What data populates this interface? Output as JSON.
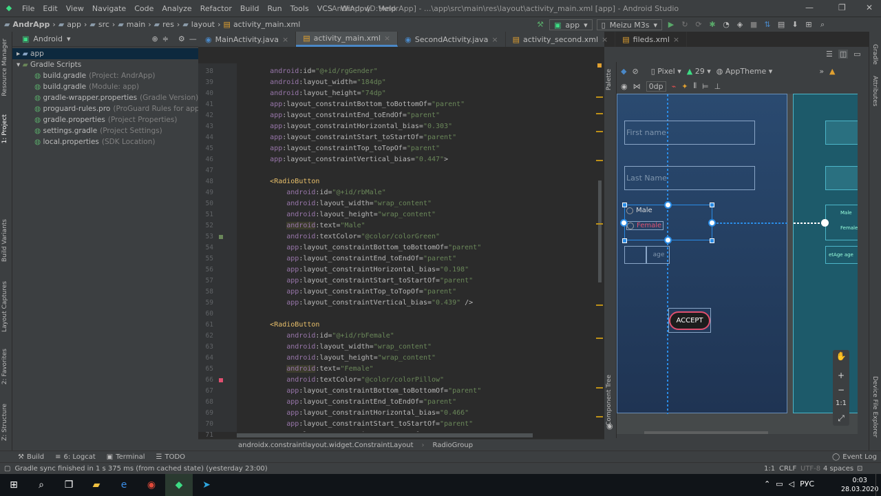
{
  "menu": [
    "File",
    "Edit",
    "View",
    "Navigate",
    "Code",
    "Analyze",
    "Refactor",
    "Build",
    "Run",
    "Tools",
    "VCS",
    "Window",
    "Help"
  ],
  "window_title": "AndrApp [D:\\AndrApp] - ...\\app\\src\\main\\res\\layout\\activity_main.xml [app] - Android Studio",
  "breadcrumb": [
    "AndrApp",
    "app",
    "src",
    "main",
    "res",
    "layout",
    "activity_main.xml"
  ],
  "run_config": "app",
  "device": "Meizu M3s",
  "left_strip": [
    "Resource Manager",
    "1: Project",
    "Build Variants",
    "Layout Captures",
    "2: Favorites",
    "Z: Structure"
  ],
  "project_view": "Android",
  "tree": [
    {
      "label": "app",
      "note": ""
    },
    {
      "label": "Gradle Scripts",
      "note": ""
    },
    {
      "label": "build.gradle",
      "note": "(Project: AndrApp)"
    },
    {
      "label": "build.gradle",
      "note": "(Module: app)"
    },
    {
      "label": "gradle-wrapper.properties",
      "note": "(Gradle Version)"
    },
    {
      "label": "proguard-rules.pro",
      "note": "(ProGuard Rules for app)"
    },
    {
      "label": "gradle.properties",
      "note": "(Project Properties)"
    },
    {
      "label": "settings.gradle",
      "note": "(Project Settings)"
    },
    {
      "label": "local.properties",
      "note": "(SDK Location)"
    }
  ],
  "tabs": [
    "MainActivity.java",
    "activity_main.xml",
    "SecondActivity.java",
    "activity_second.xml",
    "fileds.xml"
  ],
  "active_tab": 1,
  "code_lines": [
    {
      "n": "38",
      "t": "        android:id=\"@+id/rgGender\""
    },
    {
      "n": "39",
      "t": "        android:layout_width=\"184dp\""
    },
    {
      "n": "40",
      "t": "        android:layout_height=\"74dp\""
    },
    {
      "n": "41",
      "t": "        app:layout_constraintBottom_toBottomOf=\"parent\""
    },
    {
      "n": "42",
      "t": "        app:layout_constraintEnd_toEndOf=\"parent\""
    },
    {
      "n": "43",
      "t": "        app:layout_constraintHorizontal_bias=\"0.303\""
    },
    {
      "n": "44",
      "t": "        app:layout_constraintStart_toStartOf=\"parent\""
    },
    {
      "n": "45",
      "t": "        app:layout_constraintTop_toTopOf=\"parent\""
    },
    {
      "n": "46",
      "t": "        app:layout_constraintVertical_bias=\"0.447\">"
    },
    {
      "n": "47",
      "t": ""
    },
    {
      "n": "48",
      "t": "        <RadioButton"
    },
    {
      "n": "49",
      "t": "            android:id=\"@+id/rbMale\""
    },
    {
      "n": "50",
      "t": "            android:layout_width=\"wrap_content\""
    },
    {
      "n": "51",
      "t": "            android:layout_height=\"wrap_content\""
    },
    {
      "n": "52",
      "t": "            android:text=\"Male\""
    },
    {
      "n": "53",
      "t": "            android:textColor=\"@color/colorGreen\""
    },
    {
      "n": "54",
      "t": "            app:layout_constraintBottom_toBottomOf=\"parent\""
    },
    {
      "n": "55",
      "t": "            app:layout_constraintEnd_toEndOf=\"parent\""
    },
    {
      "n": "56",
      "t": "            app:layout_constraintHorizontal_bias=\"0.198\""
    },
    {
      "n": "57",
      "t": "            app:layout_constraintStart_toStartOf=\"parent\""
    },
    {
      "n": "58",
      "t": "            app:layout_constraintTop_toTopOf=\"parent\""
    },
    {
      "n": "59",
      "t": "            app:layout_constraintVertical_bias=\"0.439\" />"
    },
    {
      "n": "60",
      "t": ""
    },
    {
      "n": "61",
      "t": "        <RadioButton"
    },
    {
      "n": "62",
      "t": "            android:id=\"@+id/rbFemale\""
    },
    {
      "n": "63",
      "t": "            android:layout_width=\"wrap_content\""
    },
    {
      "n": "64",
      "t": "            android:layout_height=\"wrap_content\""
    },
    {
      "n": "65",
      "t": "            android:text=\"Female\""
    },
    {
      "n": "66",
      "t": "            android:textColor=\"@color/colorPillow\""
    },
    {
      "n": "67",
      "t": "            app:layout_constraintBottom_toBottomOf=\"parent\""
    },
    {
      "n": "68",
      "t": "            app:layout_constraintEnd_toEndOf=\"parent\""
    },
    {
      "n": "69",
      "t": "            app:layout_constraintHorizontal_bias=\"0.466\""
    },
    {
      "n": "70",
      "t": "            app:layout_constraintStart_toStartOf=\"parent\""
    },
    {
      "n": "71",
      "t": "            app:layout_constraintTop_toTopOf=\"parent\""
    }
  ],
  "editor_breadcrumb": [
    "androidx.constraintlayout.widget.ConstraintLayout",
    "RadioGroup"
  ],
  "design_toolbar": {
    "device": "Pixel",
    "api": "29",
    "theme": "AppTheme",
    "margin": "0dp"
  },
  "side_labels": {
    "palette": "Palette",
    "component_tree": "Component Tree",
    "attributes": "Attributes",
    "gradle": "Gradle",
    "device_file_explorer": "Device File Explorer"
  },
  "preview": {
    "first_name_hint": "First name",
    "last_name_hint": "Last Name",
    "male": "Male",
    "female": "Female",
    "age": "age",
    "accept": "ACCEPT",
    "blueprint_age": "etAge",
    "blueprint_age2": "age",
    "blueprint_male": "Male",
    "blueprint_female": "Female"
  },
  "zoom_controls": [
    "+",
    "−",
    "1:1"
  ],
  "bottom_tools": [
    "Build",
    "6: Logcat",
    "Terminal",
    "TODO"
  ],
  "event_log": "Event Log",
  "status_message": "Gradle sync finished in 1 s 375 ms (from cached state) (yesterday 23:00)",
  "status_right": {
    "pos": "1:1",
    "eol": "CRLF",
    "enc": "UTF-8",
    "indent": "4 spaces"
  },
  "tray": {
    "lang": "РУС",
    "time": "0:03",
    "date": "28.03.2020"
  }
}
